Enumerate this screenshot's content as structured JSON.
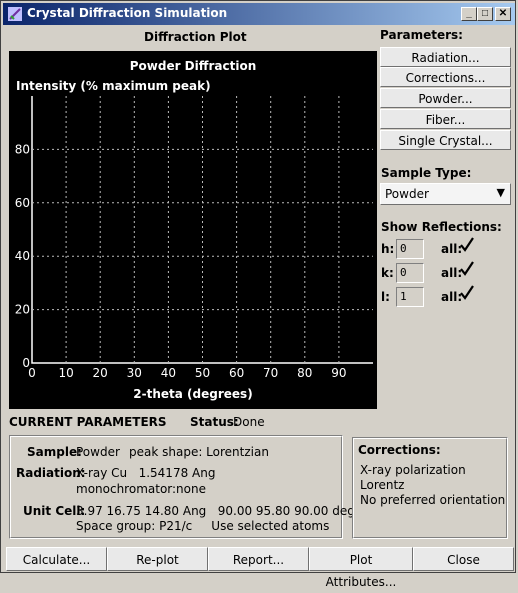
{
  "window": {
    "title": "Crystal Diffraction Simulation"
  },
  "title_buttons": {
    "minimize": "_",
    "maximize": "□",
    "close": "✕"
  },
  "plot_section": {
    "label": "Diffraction Plot"
  },
  "chart_data": {
    "type": "scatter",
    "title": "Powder Diffraction",
    "ylabel": "Intensity (% maximum peak)",
    "xlabel": "2-theta (degrees)",
    "x_ticks": [
      0,
      10,
      20,
      30,
      40,
      50,
      60,
      70,
      80,
      90
    ],
    "y_ticks": [
      0,
      20,
      40,
      60,
      80
    ],
    "xlim": [
      0,
      100
    ],
    "ylim": [
      0,
      100
    ],
    "grid": true,
    "series": []
  },
  "parameters": {
    "label": "Parameters:",
    "buttons": [
      "Radiation...",
      "Corrections...",
      "Powder...",
      "Fiber...",
      "Single Crystal..."
    ]
  },
  "sample_type": {
    "label": "Sample Type:",
    "value": "Powder",
    "arrow": "▼"
  },
  "reflections": {
    "label": "Show Reflections:",
    "all_label": "all:",
    "rows": [
      {
        "index": "h:",
        "value": "0",
        "all_checked": true
      },
      {
        "index": "k:",
        "value": "0",
        "all_checked": true
      },
      {
        "index": "l:",
        "value": "1",
        "all_checked": true
      }
    ]
  },
  "current_parameters": {
    "label": "CURRENT PARAMETERS",
    "status_label": "Status:",
    "status_value": "Done",
    "sample_label": "Sample:",
    "sample_value": "Powder",
    "peak_shape": "peak shape: Lorentzian",
    "radiation_label": "Radiation:",
    "radiation_line1": "X-ray Cu   1.54178 Ang",
    "radiation_line2": "monochromator:none",
    "unit_cell_label": "Unit Cell:",
    "unit_cell_line1": "3.97 16.75 14.80 Ang   90.00 95.80 90.00 deg",
    "unit_cell_line2": "Space group: P21/c     Use selected atoms"
  },
  "corrections": {
    "label": "Corrections:",
    "items": [
      "X-ray polarization",
      "Lorentz",
      "No preferred orientation"
    ]
  },
  "bottom_buttons": [
    "Calculate...",
    "Re-plot",
    "Report...",
    "Plot Attributes...",
    "Close"
  ],
  "colors": {
    "titlebar_start": "#0a246a",
    "titlebar_end": "#a6caf0",
    "plot_bg": "#000000",
    "plot_fg": "#ffffff"
  },
  "icons": {
    "app": "crystal-app-icon",
    "check": "checkmark-icon",
    "dropdown": "chevron-down-icon"
  }
}
